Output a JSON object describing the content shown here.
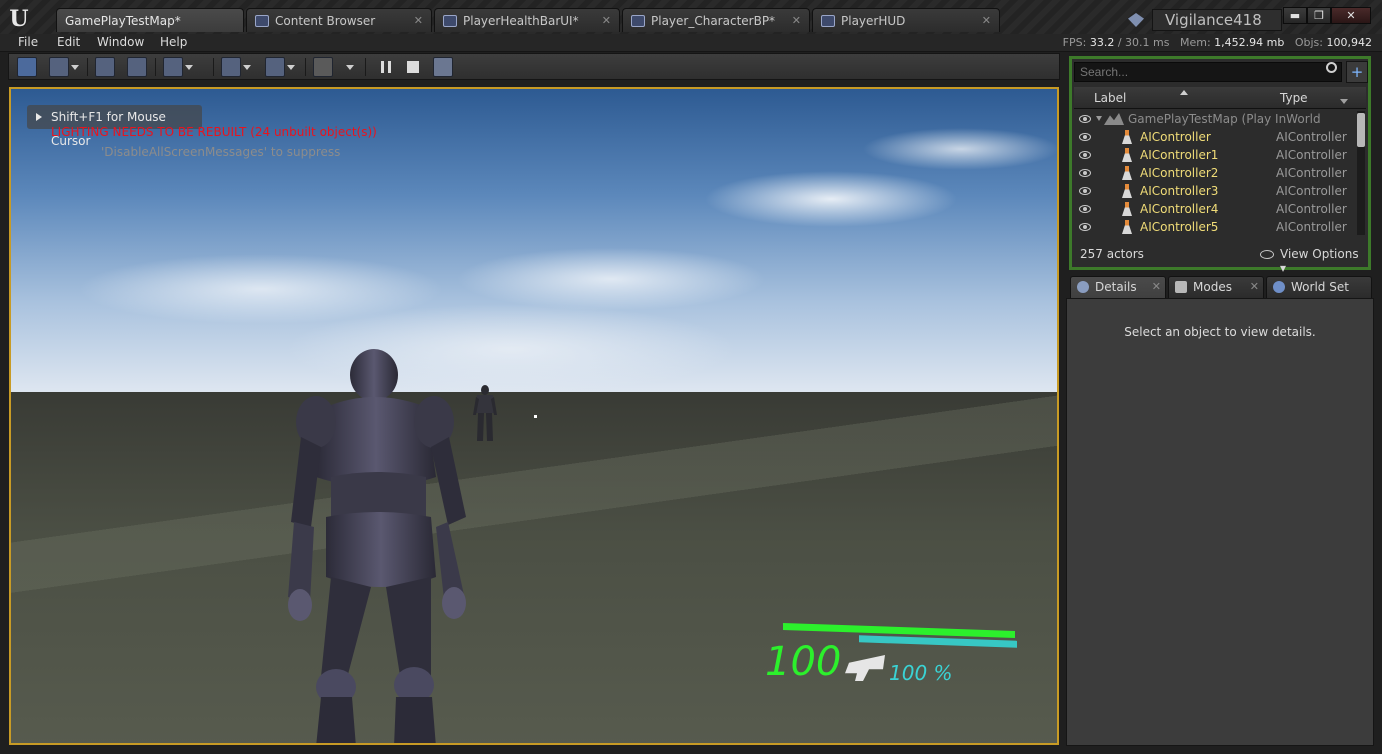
{
  "tabs": [
    {
      "label": "GamePlayTestMap*",
      "active": true
    },
    {
      "label": "Content Browser",
      "active": false
    },
    {
      "label": "PlayerHealthBarUI*",
      "active": false
    },
    {
      "label": "Player_CharacterBP*",
      "active": false
    },
    {
      "label": "PlayerHUD",
      "active": false
    }
  ],
  "profile": {
    "name": "Vigilance418"
  },
  "window_controls": {
    "minimize": "▬",
    "maximize": "❐",
    "close": "✕"
  },
  "menu": [
    "File",
    "Edit",
    "Window",
    "Help"
  ],
  "stats": {
    "fps_label": "FPS:",
    "fps": "33.2",
    "ms_sep": "/",
    "ms": "30.1 ms",
    "mem_label": "Mem:",
    "mem": "1,452.94 mb",
    "objs_label": "Objs:",
    "objs": "100,942"
  },
  "viewport": {
    "mouse_hint": "Shift+F1 for Mouse Cursor",
    "lighting_warning": "LIGHTING NEEDS TO BE REBUILT (24 unbuilt object(s))",
    "suppress_msg": "'DisableAllScreenMessages' to suppress"
  },
  "hud": {
    "health": "100",
    "ammo_percent": "100 %",
    "health_fraction": 1.0,
    "stamina_fraction": 1.0,
    "health_color": "#2cf02c",
    "stamina_color": "#37c7c4"
  },
  "outliner": {
    "search_placeholder": "Search...",
    "col_label": "Label",
    "col_type": "Type",
    "world_row": "GamePlayTestMap (Play InWorld",
    "rows": [
      {
        "label": "AIController",
        "type": "AIController"
      },
      {
        "label": "AIController1",
        "type": "AIController"
      },
      {
        "label": "AIController2",
        "type": "AIController"
      },
      {
        "label": "AIController3",
        "type": "AIController"
      },
      {
        "label": "AIController4",
        "type": "AIController"
      },
      {
        "label": "AIController5",
        "type": "AIController"
      }
    ],
    "actor_count": "257 actors",
    "view_options": "View Options",
    "border_color": "#3d7a2a"
  },
  "details": {
    "tabs": [
      "Details",
      "Modes",
      "World Set"
    ],
    "empty_message": "Select an object to view details."
  },
  "accent_color": "#c89b25"
}
